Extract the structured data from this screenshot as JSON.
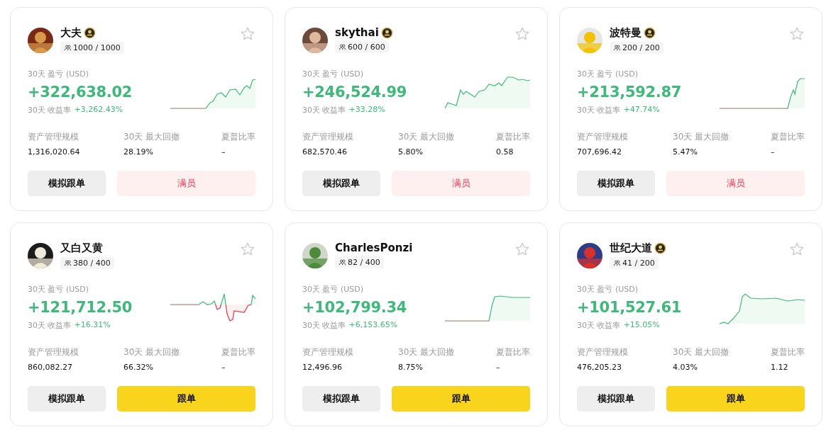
{
  "traders": [
    {
      "name": "大夫",
      "badge": true,
      "members": "1000 / 1000",
      "pnl_label": "30天 盈亏 (USD)",
      "pnl": "+322,638.02",
      "roi_label": "30天 收益率",
      "roi": "+3,262.43%",
      "stats": [
        {
          "label": "资产管理规模",
          "value": "1,316,020.64"
        },
        {
          "label": "30天 最大回撤",
          "value": "28.19%"
        },
        {
          "label": "夏普比率",
          "value": "–"
        }
      ],
      "buttons": [
        {
          "kind": "demo",
          "label": "模拟跟单"
        },
        {
          "kind": "full",
          "label": "满员"
        }
      ]
    },
    {
      "name": "skythai",
      "badge": true,
      "members": "600 / 600",
      "pnl_label": "30天 盈亏 (USD)",
      "pnl": "+246,524.99",
      "roi_label": "30天 收益率",
      "roi": "+33.28%",
      "stats": [
        {
          "label": "资产管理规模",
          "value": "682,570.46"
        },
        {
          "label": "30天 最大回撤",
          "value": "5.80%"
        },
        {
          "label": "夏普比率",
          "value": "0.58"
        }
      ],
      "buttons": [
        {
          "kind": "demo",
          "label": "模拟跟单"
        },
        {
          "kind": "full",
          "label": "满员"
        }
      ]
    },
    {
      "name": "波特曼",
      "badge": true,
      "members": "200 / 200",
      "pnl_label": "30天 盈亏 (USD)",
      "pnl": "+213,592.87",
      "roi_label": "30天 收益率",
      "roi": "+47.74%",
      "stats": [
        {
          "label": "资产管理规模",
          "value": "707,696.42"
        },
        {
          "label": "30天 最大回撤",
          "value": "5.47%"
        },
        {
          "label": "夏普比率",
          "value": "–"
        }
      ],
      "buttons": [
        {
          "kind": "demo",
          "label": "模拟跟单"
        },
        {
          "kind": "full",
          "label": "满员"
        }
      ]
    },
    {
      "name": "又白又黄",
      "badge": false,
      "members": "380 / 400",
      "pnl_label": "30天 盈亏 (USD)",
      "pnl": "+121,712.50",
      "roi_label": "30天 收益率",
      "roi": "+16.31%",
      "stats": [
        {
          "label": "资产管理规模",
          "value": "860,082.27"
        },
        {
          "label": "30天 最大回撤",
          "value": "66.32%"
        },
        {
          "label": "夏普比率",
          "value": "–"
        }
      ],
      "buttons": [
        {
          "kind": "demo",
          "label": "模拟跟单"
        },
        {
          "kind": "follow",
          "label": "跟单"
        }
      ]
    },
    {
      "name": "CharlesPonzi",
      "badge": false,
      "members": "82 / 400",
      "pnl_label": "30天 盈亏 (USD)",
      "pnl": "+102,799.34",
      "roi_label": "30天 收益率",
      "roi": "+6,153.65%",
      "stats": [
        {
          "label": "资产管理规模",
          "value": "12,496.96"
        },
        {
          "label": "30天 最大回撤",
          "value": "8.75%"
        },
        {
          "label": "夏普比率",
          "value": "–"
        }
      ],
      "buttons": [
        {
          "kind": "demo",
          "label": "模拟跟单"
        },
        {
          "kind": "follow",
          "label": "跟单"
        }
      ]
    },
    {
      "name": "世纪大道",
      "badge": true,
      "members": "41 / 200",
      "pnl_label": "30天 盈亏 (USD)",
      "pnl": "+101,527.61",
      "roi_label": "30天 收益率",
      "roi": "+15.05%",
      "stats": [
        {
          "label": "资产管理规模",
          "value": "476,205.23"
        },
        {
          "label": "30天 最大回撤",
          "value": "4.03%"
        },
        {
          "label": "夏普比率",
          "value": "1.12"
        }
      ],
      "buttons": [
        {
          "kind": "demo",
          "label": "模拟跟单"
        },
        {
          "kind": "follow",
          "label": "跟单"
        }
      ]
    }
  ]
}
